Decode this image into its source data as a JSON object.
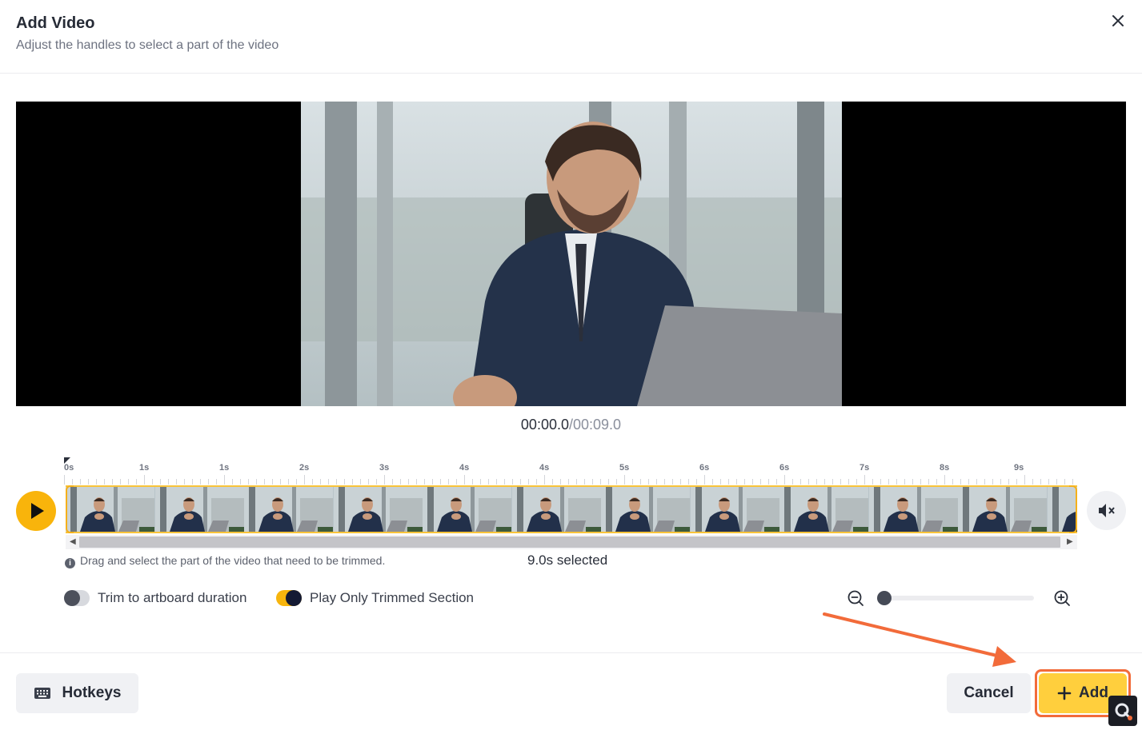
{
  "dialog": {
    "title": "Add Video",
    "subtitle": "Adjust the handles to select a part of the video"
  },
  "player": {
    "current_time": "00:00.0",
    "separator": "/",
    "duration": "00:09.0"
  },
  "timeline": {
    "tick_labels": [
      "0s",
      "1s",
      "1s",
      "2s",
      "3s",
      "4s",
      "4s",
      "5s",
      "6s",
      "6s",
      "7s",
      "8s",
      "9s"
    ],
    "thumbnail_count": 12,
    "hint": "Drag and select the part of the video that need to be trimmed.",
    "selected_text": "9.0s selected"
  },
  "options": {
    "trim_to_artboard": {
      "label": "Trim to artboard duration",
      "on": false
    },
    "play_only_trimmed": {
      "label": "Play Only Trimmed Section",
      "on": true
    }
  },
  "zoom": {
    "level": 0
  },
  "footer": {
    "hotkeys_label": "Hotkeys",
    "cancel_label": "Cancel",
    "add_label": "Add"
  },
  "colors": {
    "accent": "#f9b40b",
    "add_button": "#ffcf3d",
    "annotation": "#f26b3a"
  },
  "icons": {
    "close": "close-icon",
    "play": "play-icon",
    "mute": "mute-icon",
    "keyboard": "keyboard-icon",
    "plus": "plus-icon",
    "zoom_out": "zoom-out-icon",
    "zoom_in": "zoom-in-icon",
    "info": "info-icon"
  }
}
